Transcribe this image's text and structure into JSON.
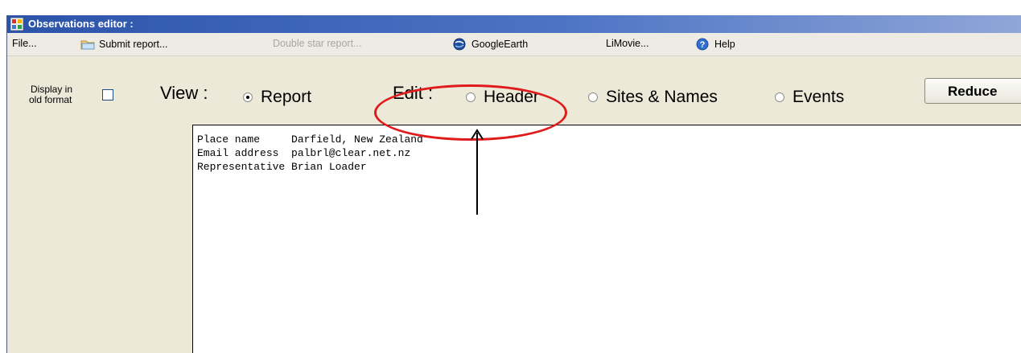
{
  "window": {
    "title": "Observations editor :"
  },
  "menu": {
    "file": "File...",
    "submit_report": "Submit report...",
    "double_star_report": "Double star report...",
    "google_earth": "GoogleEarth",
    "limovie": "LiMovie...",
    "help": "Help"
  },
  "controls": {
    "display_old_format_line1": "Display in",
    "display_old_format_line2": "old format",
    "display_old_format_checked": false,
    "view_label": "View :",
    "view_report": "Report",
    "edit_label": "Edit :",
    "edit_header": "Header",
    "edit_sites_names": "Sites & Names",
    "edit_events": "Events",
    "reduce_button": "Reduce",
    "selected_option": "Report"
  },
  "report": {
    "lines": [
      "Place name     Darfield, New Zealand",
      "Email address  palbrl@clear.net.nz",
      "Representative Brian Loader"
    ]
  },
  "colors": {
    "annotation": "#e01b1b",
    "titlebar": "#2b53a9"
  }
}
